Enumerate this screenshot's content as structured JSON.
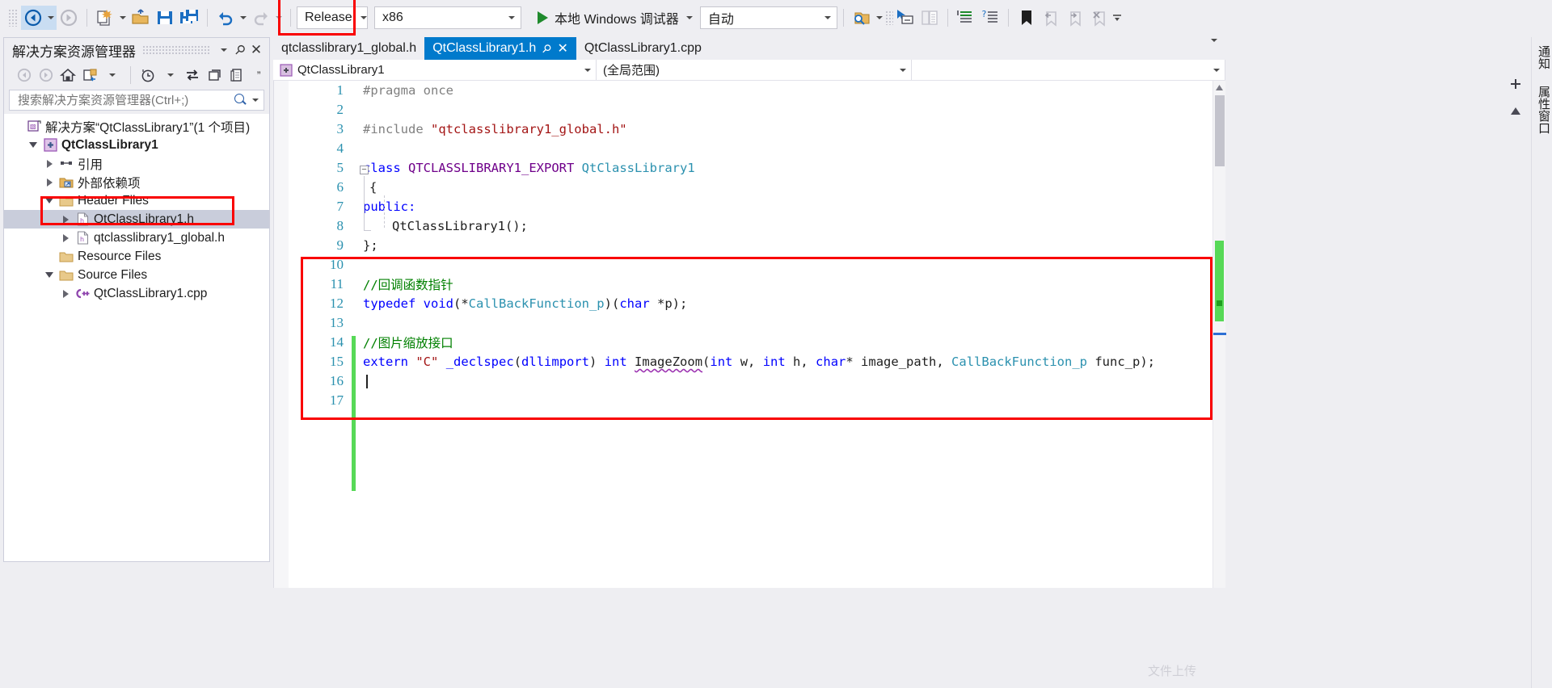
{
  "toolbar": {
    "nav_back": "navigate-back",
    "nav_forward": "navigate-forward",
    "new_item": "new-item",
    "open_file": "open-file",
    "save": "save",
    "save_all": "save-all",
    "undo": "undo",
    "redo": "redo",
    "configuration": "Release",
    "platform": "x86",
    "run_label": "本地 Windows 调试器",
    "auto_value": "自动",
    "colors": {
      "accent": "#007acc",
      "run_green": "#1f8a2d",
      "annotation_red": "#f90000"
    }
  },
  "solution_explorer": {
    "title": "解决方案资源管理器",
    "search_placeholder": "搜索解决方案资源管理器(Ctrl+;)",
    "search_value": "",
    "tree": [
      {
        "label": "解决方案“QtClassLibrary1”(1 个项目)",
        "indent": 0,
        "icon": "solution-icon",
        "twisty": "none",
        "bold": false,
        "selected": false
      },
      {
        "label": "QtClassLibrary1",
        "indent": 1,
        "icon": "project-icon",
        "twisty": "down",
        "bold": true,
        "selected": false
      },
      {
        "label": "引用",
        "indent": 2,
        "icon": "references-icon",
        "twisty": "right",
        "bold": false,
        "selected": false
      },
      {
        "label": "外部依赖项",
        "indent": 2,
        "icon": "external-deps-icon",
        "twisty": "right",
        "bold": false,
        "selected": false
      },
      {
        "label": "Header Files",
        "indent": 2,
        "icon": "folder-icon",
        "twisty": "down",
        "bold": false,
        "selected": false
      },
      {
        "label": "QtClassLibrary1.h",
        "indent": 3,
        "icon": "header-file-icon",
        "twisty": "right",
        "bold": false,
        "selected": true
      },
      {
        "label": "qtclasslibrary1_global.h",
        "indent": 3,
        "icon": "header-file-icon",
        "twisty": "right",
        "bold": false,
        "selected": false
      },
      {
        "label": "Resource Files",
        "indent": 2,
        "icon": "folder-icon",
        "twisty": "none",
        "bold": false,
        "selected": false
      },
      {
        "label": "Source Files",
        "indent": 2,
        "icon": "folder-icon",
        "twisty": "down",
        "bold": false,
        "selected": false
      },
      {
        "label": "QtClassLibrary1.cpp",
        "indent": 3,
        "icon": "cpp-file-icon",
        "twisty": "right",
        "bold": false,
        "selected": false
      }
    ]
  },
  "editor": {
    "tabs": [
      {
        "label": "qtclasslibrary1_global.h",
        "active": false
      },
      {
        "label": "QtClassLibrary1.h",
        "active": true
      },
      {
        "label": "QtClassLibrary1.cpp",
        "active": false
      }
    ],
    "breadcrumb_scope": "QtClassLibrary1",
    "breadcrumb_member": "(全局范围)",
    "lines": [
      {
        "no": "1",
        "changed": false
      },
      {
        "no": "2",
        "changed": false
      },
      {
        "no": "3",
        "changed": false
      },
      {
        "no": "4",
        "changed": false
      },
      {
        "no": "5",
        "changed": false
      },
      {
        "no": "6",
        "changed": false
      },
      {
        "no": "7",
        "changed": false
      },
      {
        "no": "8",
        "changed": false
      },
      {
        "no": "9",
        "changed": false
      },
      {
        "no": "10",
        "changed": true
      },
      {
        "no": "11",
        "changed": true
      },
      {
        "no": "12",
        "changed": true
      },
      {
        "no": "13",
        "changed": true
      },
      {
        "no": "14",
        "changed": true
      },
      {
        "no": "15",
        "changed": true
      },
      {
        "no": "16",
        "changed": true
      },
      {
        "no": "17",
        "changed": true
      }
    ],
    "code_text": {
      "l1": "#pragma once",
      "l3_kw": "#include",
      "l3_str": "\"qtclasslibrary1_global.h\"",
      "l5_class": "class",
      "l5_macro": "QTCLASSLIBRARY1_EXPORT",
      "l5_name": "QtClassLibrary1",
      "l6": "{",
      "l7": "public:",
      "l8": "QtClassLibrary1();",
      "l9": "};",
      "l11_comment": "//回调函数指针",
      "l12_typedef": "typedef",
      "l12_void": "void",
      "l12_a": "(*",
      "l12_fnptr": "CallBackFunction_p",
      "l12_b": ")(",
      "l12_char": "char",
      "l12_c": " *p);",
      "l14_comment": "//图片缩放接口",
      "l15_extern": "extern",
      "l15_cstr": "\"C\"",
      "l15_declspec": "_declspec",
      "l15_open": "(",
      "l15_dllimport": "dllimport",
      "l15_close": ") ",
      "l15_int": "int",
      "l15_fn": "ImageZoom",
      "l15_p1o": "(",
      "l15_int2": "int",
      "l15_w": " w, ",
      "l15_int3": "int",
      "l15_h": " h, ",
      "l15_char": "char",
      "l15_path": "* image_path, ",
      "l15_cb": "CallBackFunction_p",
      "l15_func": " func_p);"
    }
  },
  "right_dock": {
    "tab_notify": "通知",
    "tab_props": "属性窗口"
  },
  "watermark": "文件上传"
}
